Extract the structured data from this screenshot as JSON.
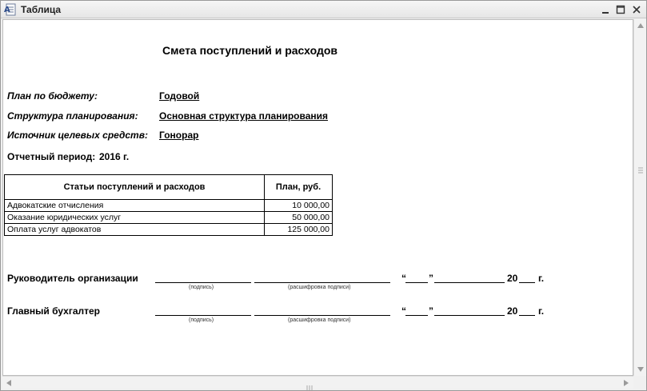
{
  "window": {
    "title": "Таблица"
  },
  "document": {
    "title": "Смета поступлений и расходов",
    "fields": [
      {
        "label": "План по бюджету:",
        "value": "Годовой"
      },
      {
        "label": "Структура планирования:",
        "value": "Основная структура планирования"
      },
      {
        "label": "Источник целевых средств:",
        "value": "Гонорар"
      }
    ],
    "period": {
      "label": "Отчетный период:",
      "value": "2016 г."
    },
    "table": {
      "headers": [
        "Статьи поступлений и расходов",
        "План,  руб."
      ],
      "rows": [
        {
          "item": "Адвокатские отчисления",
          "amount": "10 000,00"
        },
        {
          "item": "Оказание юридических услуг",
          "amount": "50 000,00"
        },
        {
          "item": "Оплата услуг адвокатов",
          "amount": "125 000,00"
        }
      ]
    },
    "signatures": [
      {
        "role": "Руководитель организации",
        "sign_caption": "(подпись)",
        "decode_caption": "(расшифровка  подписи)",
        "quote_open": "“",
        "quote_close": "”",
        "year_prefix": "20",
        "year_suffix": "г."
      },
      {
        "role": "Главный бухгалтер",
        "sign_caption": "(подпись)",
        "decode_caption": "(расшифровка  подписи)",
        "quote_open": "“",
        "quote_close": "”",
        "year_prefix": "20",
        "year_suffix": "г."
      }
    ]
  },
  "icons": {
    "app": "document-table-icon",
    "minimize": "minimize-icon",
    "maximize": "maximize-icon",
    "close": "close-icon"
  },
  "colors": {
    "titlebar": "#ececec",
    "paper": "#ffffff",
    "scrollbar": "#f2f2f2"
  }
}
